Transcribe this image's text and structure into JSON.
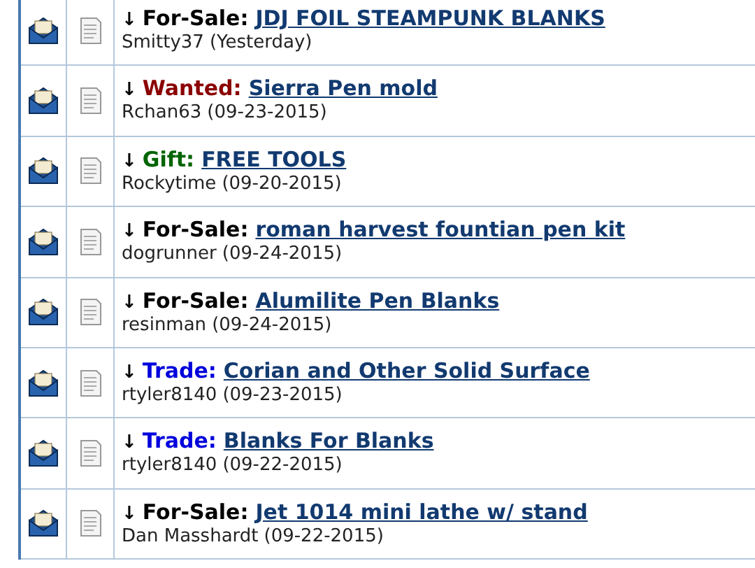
{
  "threads": [
    {
      "arrow": "↓",
      "kind": "for-sale",
      "prefix": "For-Sale:",
      "title": "JDJ FOIL STEAMPUNK BLANKS",
      "author": "Smitty37",
      "date": "(Yesterday)"
    },
    {
      "arrow": "↓",
      "kind": "wanted",
      "prefix": "Wanted:",
      "title": "Sierra Pen mold",
      "author": "Rchan63",
      "date": "(09-23-2015)"
    },
    {
      "arrow": "↓",
      "kind": "gift",
      "prefix": "Gift:",
      "title": "FREE TOOLS",
      "author": "Rockytime",
      "date": "(09-20-2015)"
    },
    {
      "arrow": "↓",
      "kind": "for-sale",
      "prefix": "For-Sale:",
      "title": "roman harvest fountian pen kit",
      "author": "dogrunner",
      "date": "(09-24-2015)"
    },
    {
      "arrow": "↓",
      "kind": "for-sale",
      "prefix": "For-Sale:",
      "title": "Alumilite Pen Blanks",
      "author": "resinman",
      "date": "(09-24-2015)"
    },
    {
      "arrow": "↓",
      "kind": "trade",
      "prefix": "Trade:",
      "title": "Corian and Other Solid Surface",
      "author": "rtyler8140",
      "date": "(09-23-2015)"
    },
    {
      "arrow": "↓",
      "kind": "trade",
      "prefix": "Trade:",
      "title": "Blanks For Blanks",
      "author": "rtyler8140",
      "date": "(09-22-2015)"
    },
    {
      "arrow": "↓",
      "kind": "for-sale",
      "prefix": "For-Sale:",
      "title": "Jet 1014 mini lathe w/ stand",
      "author": "Dan Masshardt",
      "date": "(09-22-2015)"
    }
  ]
}
